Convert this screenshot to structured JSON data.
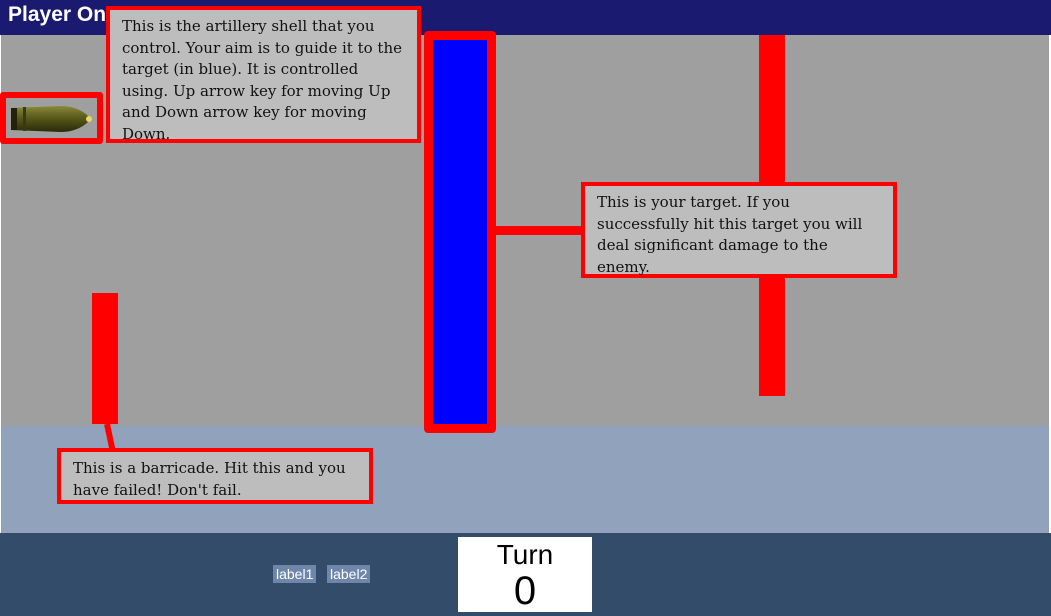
{
  "window": {
    "title": "Player On"
  },
  "callouts": {
    "shell": "This is the artillery shell that you control. Your aim is to guide it to the target (in blue). It is controlled using. Up arrow key for moving Up and Down arrow key for moving Down.",
    "target": "This is your target. If you successfully hit this target you will deal significant damage to the enemy.",
    "barricade": "This is a barricade. Hit this and you have failed! Don't fail."
  },
  "labels": {
    "label1": "label1",
    "label2": "label2"
  },
  "turn": {
    "label": "Turn",
    "value": "0"
  },
  "colors": {
    "titlebar": "#191a70",
    "field": "#9f9f9f",
    "strip": "#91a3bc",
    "bottombar": "#334c69",
    "target": "#0000ff",
    "highlight": "#ff0000",
    "barricade": "#ff0000"
  },
  "icons": {
    "shell": "artillery-shell-icon"
  }
}
